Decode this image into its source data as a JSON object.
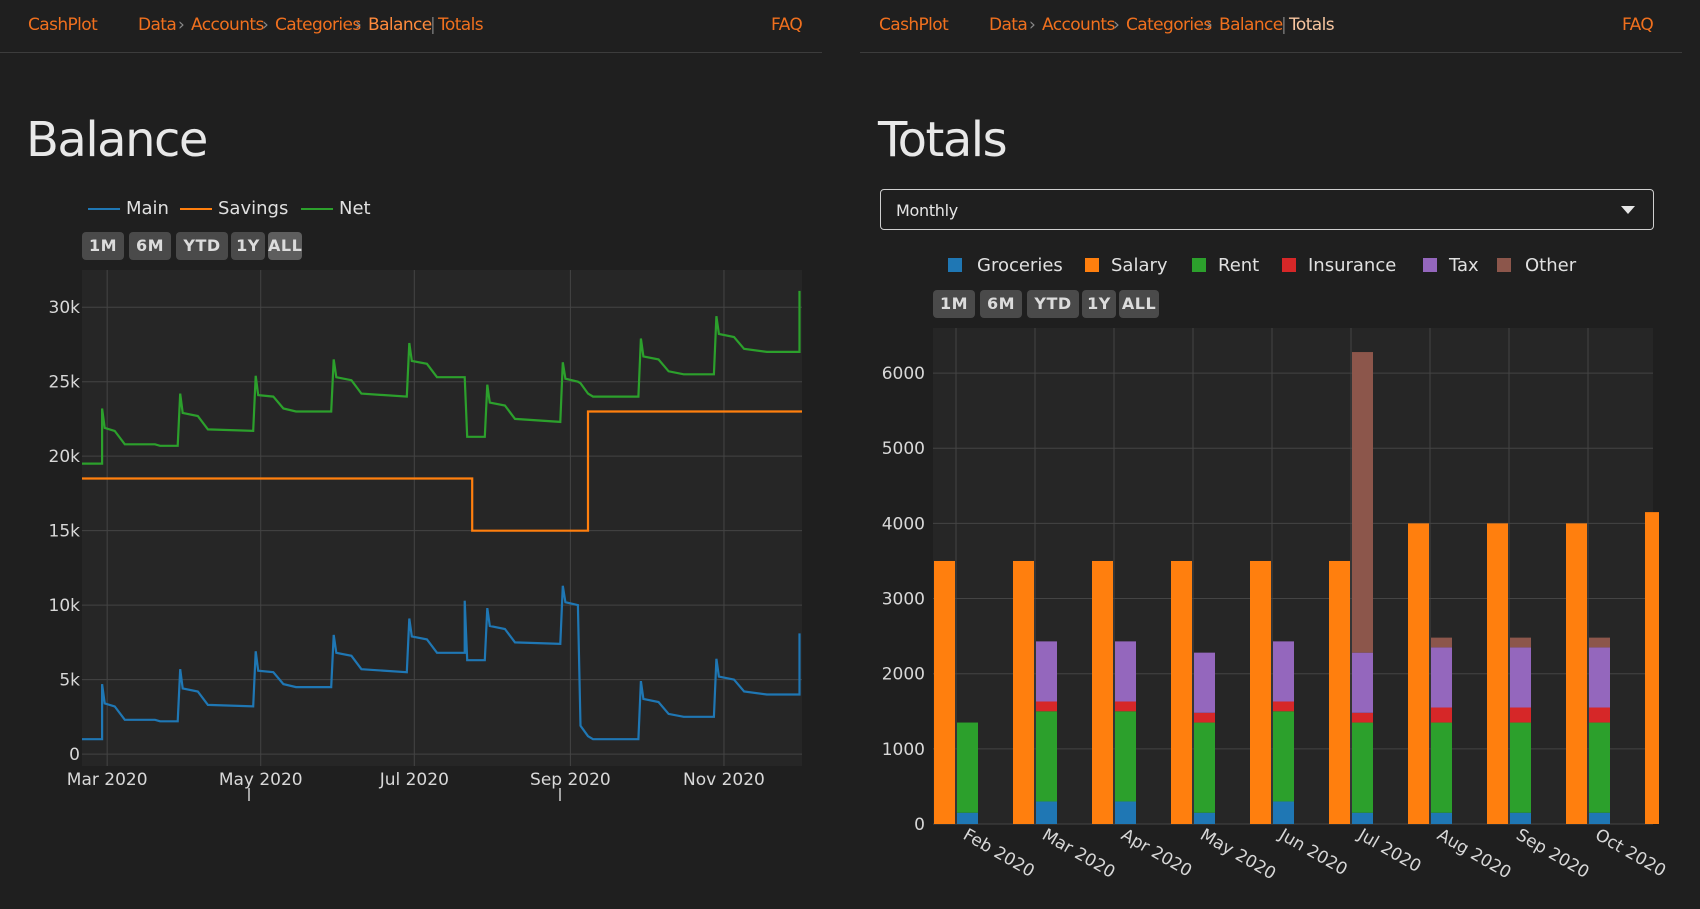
{
  "left": {
    "nav": {
      "brand": "CashPlot",
      "data": "Data",
      "accounts": "Accounts",
      "categories": "Categories",
      "balance": "Balance",
      "totals": "Totals",
      "faq": "FAQ"
    },
    "title": "Balance",
    "legend": [
      {
        "name": "Main",
        "color": "#1f77b4"
      },
      {
        "name": "Savings",
        "color": "#ff7f0e"
      },
      {
        "name": "Net",
        "color": "#2ca02c"
      }
    ],
    "ranges": [
      "1M",
      "6M",
      "YTD",
      "1Y",
      "ALL"
    ]
  },
  "right": {
    "nav": {
      "brand": "CashPlot",
      "data": "Data",
      "accounts": "Accounts",
      "categories": "Categories",
      "balance": "Balance",
      "totals": "Totals",
      "faq": "FAQ"
    },
    "title": "Totals",
    "dropdown": {
      "selected": "Monthly"
    },
    "legend": [
      {
        "name": "Groceries",
        "color": "#1f77b4"
      },
      {
        "name": "Salary",
        "color": "#ff7f0e"
      },
      {
        "name": "Rent",
        "color": "#2ca02c"
      },
      {
        "name": "Insurance",
        "color": "#d62728"
      },
      {
        "name": "Tax",
        "color": "#9467bd"
      },
      {
        "name": "Other",
        "color": "#8c564b"
      }
    ],
    "ranges": [
      "1M",
      "6M",
      "YTD",
      "1Y",
      "ALL"
    ]
  },
  "chart_data": [
    {
      "type": "line",
      "y_ticks": [
        "0",
        "5k",
        "10k",
        "15k",
        "20k",
        "25k",
        "30k"
      ],
      "x_ticks": [
        "Mar 2020",
        "May 2020",
        "Jul 2020",
        "Sep 2020",
        "Nov 2020"
      ],
      "ylim": [
        -800,
        32500
      ],
      "xlim": [
        "2020-02-20",
        "2020-12-02"
      ],
      "grid": true,
      "legend_position": "top-left",
      "series": [
        {
          "name": "Main",
          "color": "#1f77b4",
          "shape": "step",
          "points": [
            [
              "2020-02-20",
              1000
            ],
            [
              "2020-02-28",
              1000
            ],
            [
              "2020-02-28",
              4700
            ],
            [
              "2020-02-29",
              3400
            ],
            [
              "2020-03-04",
              3200
            ],
            [
              "2020-03-08",
              2300
            ],
            [
              "2020-03-20",
              2300
            ],
            [
              "2020-03-22",
              2200
            ],
            [
              "2020-03-29",
              2200
            ],
            [
              "2020-03-30",
              5700
            ],
            [
              "2020-03-31",
              4400
            ],
            [
              "2020-04-06",
              4200
            ],
            [
              "2020-04-10",
              3300
            ],
            [
              "2020-04-28",
              3200
            ],
            [
              "2020-04-29",
              6900
            ],
            [
              "2020-04-30",
              5600
            ],
            [
              "2020-05-06",
              5500
            ],
            [
              "2020-05-10",
              4700
            ],
            [
              "2020-05-15",
              4500
            ],
            [
              "2020-05-29",
              4500
            ],
            [
              "2020-05-30",
              8000
            ],
            [
              "2020-05-31",
              6800
            ],
            [
              "2020-06-06",
              6600
            ],
            [
              "2020-06-10",
              5700
            ],
            [
              "2020-06-28",
              5500
            ],
            [
              "2020-06-29",
              9100
            ],
            [
              "2020-06-30",
              7900
            ],
            [
              "2020-07-06",
              7700
            ],
            [
              "2020-07-10",
              6800
            ],
            [
              "2020-07-21",
              6800
            ],
            [
              "2020-07-21",
              10300
            ],
            [
              "2020-07-22",
              6300
            ],
            [
              "2020-07-29",
              6300
            ],
            [
              "2020-07-30",
              9800
            ],
            [
              "2020-07-31",
              8600
            ],
            [
              "2020-08-06",
              8400
            ],
            [
              "2020-08-10",
              7500
            ],
            [
              "2020-08-28",
              7400
            ],
            [
              "2020-08-29",
              11300
            ],
            [
              "2020-08-30",
              10200
            ],
            [
              "2020-09-04",
              10000
            ],
            [
              "2020-09-05",
              1900
            ],
            [
              "2020-09-08",
              1200
            ],
            [
              "2020-09-10",
              1000
            ],
            [
              "2020-09-28",
              1000
            ],
            [
              "2020-09-29",
              4900
            ],
            [
              "2020-09-30",
              3700
            ],
            [
              "2020-10-06",
              3500
            ],
            [
              "2020-10-10",
              2700
            ],
            [
              "2020-10-16",
              2500
            ],
            [
              "2020-10-28",
              2500
            ],
            [
              "2020-10-29",
              6400
            ],
            [
              "2020-10-30",
              5200
            ],
            [
              "2020-11-05",
              5000
            ],
            [
              "2020-11-09",
              4200
            ],
            [
              "2020-11-18",
              4000
            ],
            [
              "2020-12-01",
              4000
            ],
            [
              "2020-12-01",
              8100
            ]
          ]
        },
        {
          "name": "Savings",
          "color": "#ff7f0e",
          "shape": "step",
          "points": [
            [
              "2020-02-20",
              18500
            ],
            [
              "2020-07-24",
              18500
            ],
            [
              "2020-07-24",
              15000
            ],
            [
              "2020-09-08",
              15000
            ],
            [
              "2020-09-08",
              23000
            ],
            [
              "2020-12-02",
              23000
            ]
          ]
        },
        {
          "name": "Net",
          "color": "#2ca02c",
          "shape": "step",
          "points": [
            [
              "2020-02-20",
              19500
            ],
            [
              "2020-02-28",
              19500
            ],
            [
              "2020-02-28",
              23200
            ],
            [
              "2020-02-29",
              21900
            ],
            [
              "2020-03-04",
              21700
            ],
            [
              "2020-03-08",
              20800
            ],
            [
              "2020-03-20",
              20800
            ],
            [
              "2020-03-22",
              20700
            ],
            [
              "2020-03-29",
              20700
            ],
            [
              "2020-03-30",
              24200
            ],
            [
              "2020-03-31",
              22900
            ],
            [
              "2020-04-06",
              22700
            ],
            [
              "2020-04-10",
              21800
            ],
            [
              "2020-04-28",
              21700
            ],
            [
              "2020-04-29",
              25400
            ],
            [
              "2020-04-30",
              24100
            ],
            [
              "2020-05-06",
              24000
            ],
            [
              "2020-05-10",
              23200
            ],
            [
              "2020-05-15",
              23000
            ],
            [
              "2020-05-29",
              23000
            ],
            [
              "2020-05-30",
              26500
            ],
            [
              "2020-05-31",
              25300
            ],
            [
              "2020-06-06",
              25100
            ],
            [
              "2020-06-10",
              24200
            ],
            [
              "2020-06-28",
              24000
            ],
            [
              "2020-06-29",
              27600
            ],
            [
              "2020-06-30",
              26400
            ],
            [
              "2020-07-06",
              26200
            ],
            [
              "2020-07-10",
              25300
            ],
            [
              "2020-07-21",
              25300
            ],
            [
              "2020-07-22",
              21300
            ],
            [
              "2020-07-29",
              21300
            ],
            [
              "2020-07-30",
              24800
            ],
            [
              "2020-07-31",
              23600
            ],
            [
              "2020-08-06",
              23400
            ],
            [
              "2020-08-10",
              22500
            ],
            [
              "2020-08-28",
              22300
            ],
            [
              "2020-08-29",
              26300
            ],
            [
              "2020-08-30",
              25200
            ],
            [
              "2020-09-04",
              25000
            ],
            [
              "2020-09-05",
              24900
            ],
            [
              "2020-09-08",
              24200
            ],
            [
              "2020-09-10",
              24000
            ],
            [
              "2020-09-28",
              24000
            ],
            [
              "2020-09-29",
              27900
            ],
            [
              "2020-09-30",
              26700
            ],
            [
              "2020-10-06",
              26500
            ],
            [
              "2020-10-10",
              25700
            ],
            [
              "2020-10-16",
              25500
            ],
            [
              "2020-10-28",
              25500
            ],
            [
              "2020-10-29",
              29400
            ],
            [
              "2020-10-30",
              28200
            ],
            [
              "2020-11-05",
              28000
            ],
            [
              "2020-11-09",
              27200
            ],
            [
              "2020-11-18",
              27000
            ],
            [
              "2020-12-01",
              27000
            ],
            [
              "2020-12-01",
              31100
            ]
          ]
        }
      ]
    },
    {
      "type": "bar",
      "categories": [
        "Feb 2020",
        "Mar 2020",
        "Apr 2020",
        "May 2020",
        "Jun 2020",
        "Jul 2020",
        "Aug 2020",
        "Sep 2020",
        "Oct 2020"
      ],
      "y_ticks": [
        "0",
        "1000",
        "2000",
        "3000",
        "4000",
        "5000",
        "6000"
      ],
      "ylim": [
        0,
        6600
      ],
      "grid": true,
      "legend_position": "top-left",
      "series": [
        {
          "name": "Salary",
          "color": "#ff7f0e",
          "values": [
            3500,
            3500,
            3500,
            3500,
            3500,
            3500,
            4000,
            4000,
            4000
          ],
          "extra_value": 4150
        },
        {
          "name": "Groceries",
          "color": "#1f77b4",
          "values": [
            150,
            300,
            300,
            150,
            300,
            150,
            150,
            150,
            150
          ]
        },
        {
          "name": "Rent",
          "color": "#2ca02c",
          "values": [
            1200,
            1200,
            1200,
            1200,
            1200,
            1200,
            1200,
            1200,
            1200
          ]
        },
        {
          "name": "Insurance",
          "color": "#d62728",
          "values": [
            0,
            130,
            130,
            130,
            130,
            130,
            200,
            200,
            200
          ]
        },
        {
          "name": "Tax",
          "color": "#9467bd",
          "values": [
            0,
            800,
            800,
            800,
            800,
            800,
            800,
            800,
            800
          ]
        },
        {
          "name": "Other",
          "color": "#8c564b",
          "values": [
            0,
            0,
            0,
            0,
            0,
            4000,
            130,
            130,
            130
          ]
        }
      ]
    }
  ]
}
